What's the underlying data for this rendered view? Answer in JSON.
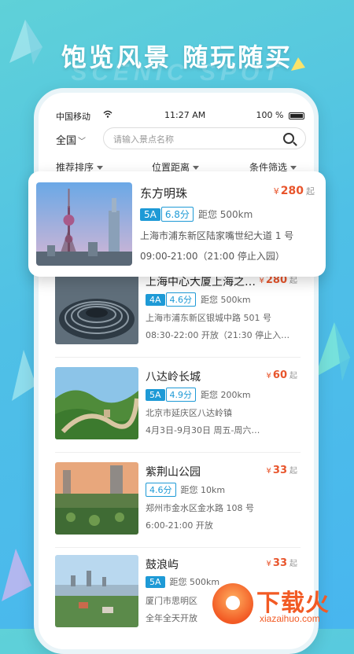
{
  "promo": {
    "headline": "饱览风景 随玩随买",
    "watermark": "SCENIC SPOT"
  },
  "status_bar": {
    "carrier": "中国移动",
    "time": "11:27 AM",
    "battery": "100 %"
  },
  "search": {
    "region": "全国",
    "placeholder": "请输入景点名称"
  },
  "sort_bar": {
    "recommended": "推荐排序",
    "distance": "位置距离",
    "filter": "条件筛选"
  },
  "currency_symbol": "¥",
  "price_suffix": "起",
  "featured": {
    "name": "东方明珠",
    "price": "280",
    "grade": "5A",
    "score": "6.8分",
    "distance": "距您 500km",
    "address": "上海市浦东新区陆家嘴世纪大道 1 号",
    "hours": "09:00-21:00（21:00 停止入园）"
  },
  "spots": [
    {
      "name": "上海中心大厦上海之…",
      "price": "280",
      "grade": "4A",
      "score": "4.6分",
      "distance": "距您 500km",
      "address": "上海市浦东新区银城中路 501 号",
      "hours": "08:30-22:00 开放（21:30 停止入…"
    },
    {
      "name": "八达岭长城",
      "price": "60",
      "grade": "5A",
      "score": "4.9分",
      "distance": "距您 200km",
      "address": "北京市延庆区八达岭镇",
      "hours": "4月3日-9月30日 周五-周六…"
    },
    {
      "name": "紫荆山公园",
      "price": "33",
      "grade": "",
      "score": "4.6分",
      "distance": "距您 10km",
      "address": "郑州市金水区金水路 108 号",
      "hours": "6:00-21:00 开放"
    },
    {
      "name": "鼓浪屿",
      "price": "33",
      "grade": "5A",
      "score": "",
      "distance": "距您 500km",
      "address": "厦门市思明区",
      "hours": "全年全天开放"
    }
  ],
  "logo": {
    "text": "下载火",
    "url": "xiazaihuo.com"
  },
  "colors": {
    "accent_blue": "#1e9ad6",
    "price_red": "#e8552c",
    "background": "#4fc0e6"
  }
}
